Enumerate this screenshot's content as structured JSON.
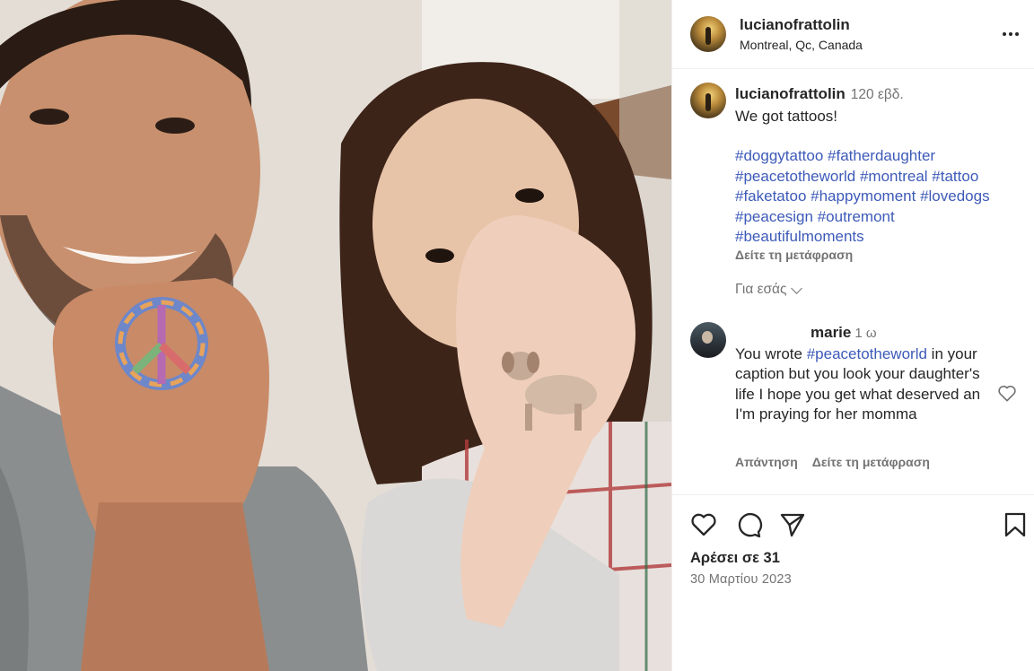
{
  "post": {
    "username": "lucianofrattolin",
    "location": "Montreal, Qc, Canada"
  },
  "caption": {
    "username": "lucianofrattolin",
    "time": "120 εβδ.",
    "text": "We got tattoos!",
    "hashtags": [
      [
        "#doggytattoo",
        "#fatherdaughter"
      ],
      [
        "#peacetotheworld",
        "#montreal",
        "#tattoo"
      ],
      [
        "#faketatoo",
        "#happymoment",
        "#lovedogs"
      ],
      [
        "#peacesign",
        "#outremont"
      ],
      [
        "#beautifulmoments"
      ]
    ],
    "see_translation": "Δείτε τη μετάφραση"
  },
  "for_you": "Για εσάς",
  "comment": {
    "username": "marie",
    "time": "1 ω",
    "text_before": "You wrote ",
    "hashtag": "#peacetotheworld",
    "text_after": " in your caption but you look your daughter's life I hope you get what deserved an I'm praying for her momma",
    "reply": "Απάντηση",
    "see_translation": "Δείτε τη μετάφραση"
  },
  "likes": "Αρέσει σε 31",
  "date": "30 Μαρτίου 2023",
  "colors": {
    "link": "#3d5ab8",
    "muted": "#737373",
    "text": "#262626"
  },
  "icons": {
    "more": "more-options-icon",
    "like": "heart-icon",
    "comment": "comment-bubble-icon",
    "share": "paper-plane-icon",
    "save": "bookmark-icon"
  }
}
